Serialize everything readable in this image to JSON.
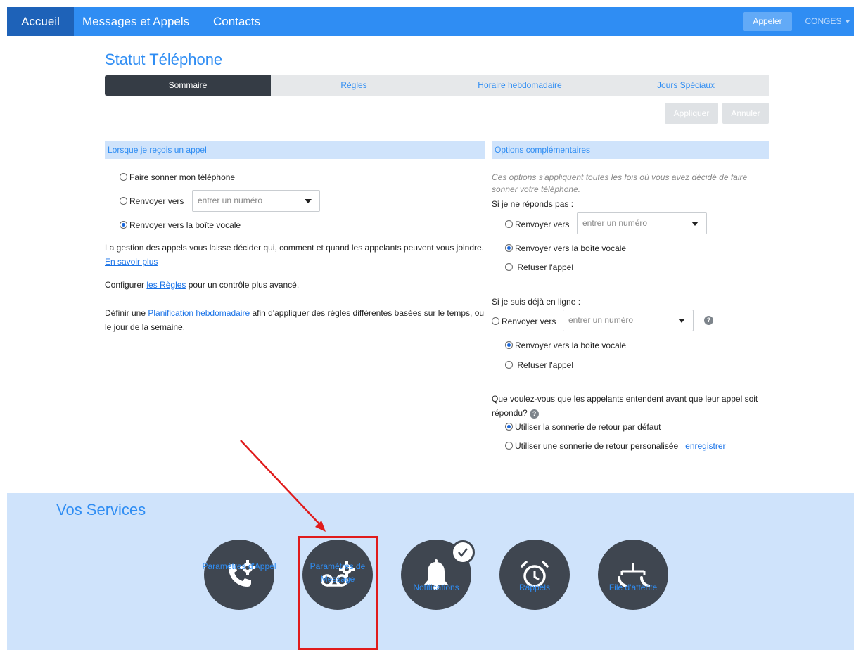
{
  "nav": {
    "home": "Accueil",
    "messages": "Messages et Appels",
    "contacts": "Contacts",
    "call_button": "Appeler",
    "profile_menu": "CONGES"
  },
  "page_title": "Statut Téléphone",
  "tabs": [
    "Sommaire",
    "Règles",
    "Horaire hebdomadaire",
    "Jours Spéciaux"
  ],
  "actions": {
    "apply": "Appliquer",
    "cancel": "Annuler"
  },
  "left": {
    "header": "Lorsque je reçois un appel",
    "option_ring": "Faire sonner mon téléphone",
    "option_forward": "Renvoyer vers",
    "forward_placeholder": "entrer un numéro",
    "option_voicemail": "Renvoyer vers la boîte vocale",
    "selected": "voicemail",
    "info1_text": "La gestion des appels vous laisse décider qui, comment et quand les appelants peuvent vous joindre.",
    "info1_link": "En savoir plus",
    "info2_prefix": "Configurer ",
    "info2_link": "les Règles",
    "info2_suffix": " pour un contrôle plus avancé.",
    "info3_prefix": "Définir une ",
    "info3_link": "Planification hebdomadaire",
    "info3_suffix": " afin d'appliquer des règles différentes basées sur le temps, ou le jour de la semaine."
  },
  "right": {
    "header": "Options complémentaires",
    "note": "Ces options s'appliquent toutes les fois où vous avez décidé de faire sonner votre téléphone.",
    "no_answer_label": "Si je ne réponds pas :",
    "no_answer_forward": "Renvoyer vers",
    "no_answer_placeholder": "entrer un numéro",
    "no_answer_voicemail": "Renvoyer vers la boîte vocale",
    "no_answer_reject": "Refuser l'appel",
    "busy_label": "Si je suis déjà en ligne :",
    "busy_forward": "Renvoyer vers",
    "busy_placeholder": "entrer un numéro",
    "busy_voicemail": "Renvoyer vers la boîte vocale",
    "busy_reject": "Refuser l'appel",
    "ringback_question": "Que voulez-vous que les appelants entendent avant que leur appel soit répondu?",
    "ringback_default": "Utiliser la sonnerie de retour par défaut",
    "ringback_custom": "Utiliser une sonnerie de retour personalisée",
    "ringback_record_link": "enregistrer"
  },
  "services": {
    "title": "Vos Services",
    "items": [
      {
        "label": "Paramètres d'Appel",
        "icon": "phone-gear-icon"
      },
      {
        "label": "Paramètres de Message",
        "icon": "voicemail-gear-icon"
      },
      {
        "label": "Notifications",
        "icon": "bell-icon",
        "checked": true
      },
      {
        "label": "Rappels",
        "icon": "alarm-clock-icon"
      },
      {
        "label": "File d'attente",
        "icon": "call-queue-icon"
      }
    ]
  },
  "annotation_color": "#e01b1b",
  "accent_color": "#2f8df3"
}
